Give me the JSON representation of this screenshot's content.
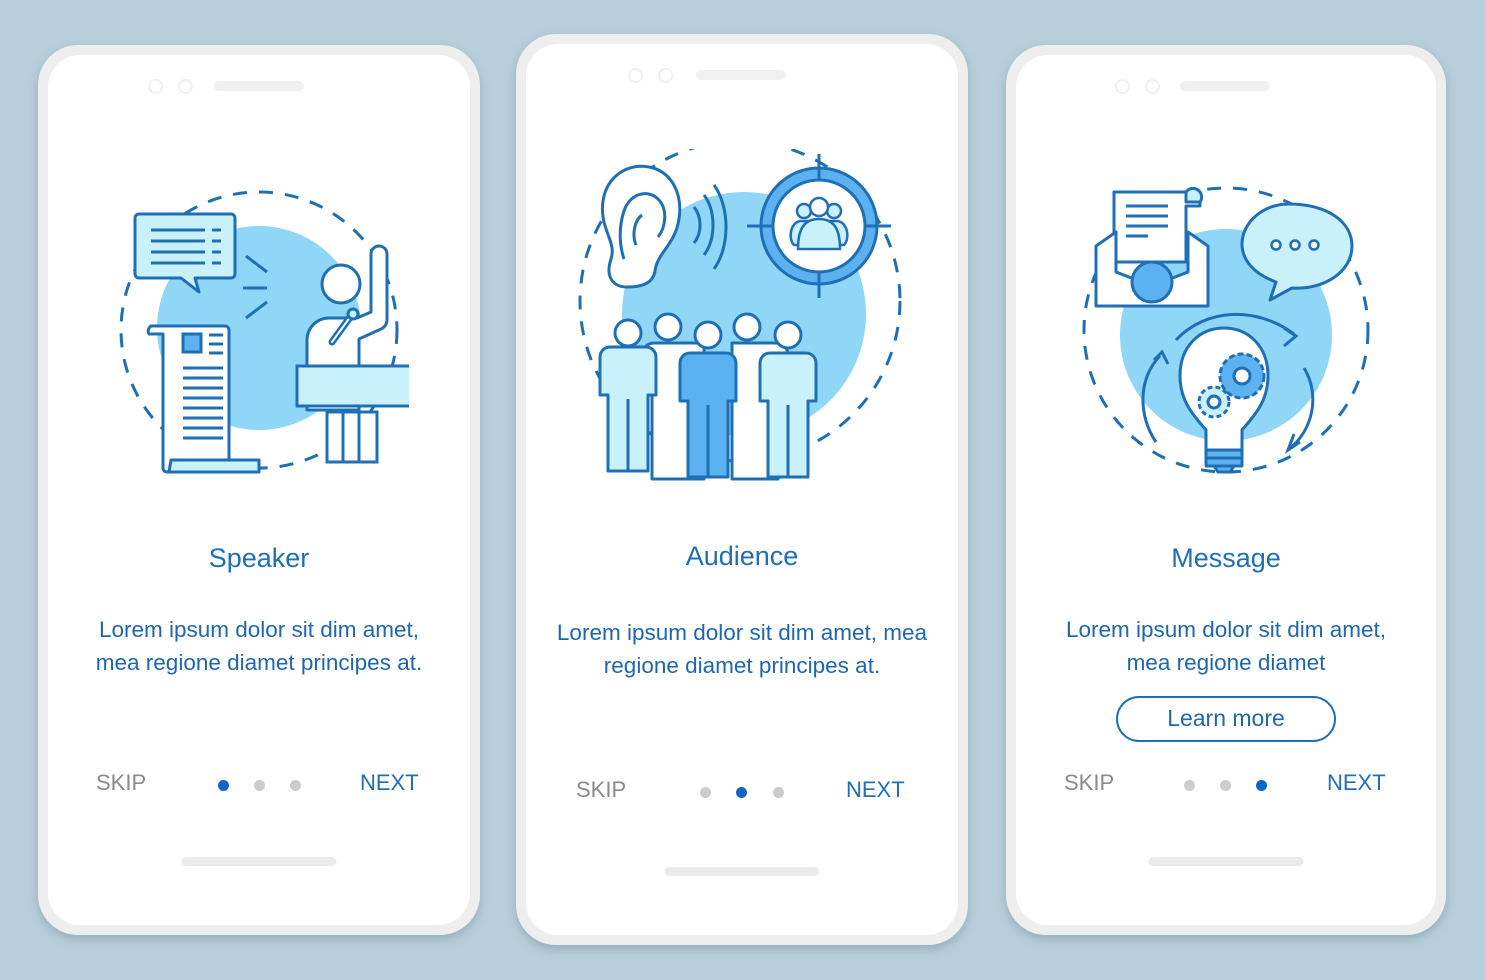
{
  "colors": {
    "background": "#b9cfdb",
    "accent": "#1f6fb5",
    "active_dot": "#0f66c2",
    "inactive_dot": "#cccccc",
    "skip_text": "#8a8a8a",
    "illustration_fill_light": "#8fd6f7",
    "illustration_fill_pale": "#c9f1fc",
    "illustration_fill_mid": "#5cb2f0"
  },
  "screens": [
    {
      "illustration": "speaker-illustration",
      "title": "Speaker",
      "body": "Lorem ipsum dolor sit dim amet, mea regione diamet principes at.",
      "skip_label": "SKIP",
      "next_label": "NEXT",
      "page_index": 1,
      "page_count": 3
    },
    {
      "illustration": "audience-illustration",
      "title": "Audience",
      "body": "Lorem ipsum dolor sit dim amet, mea regione diamet principes at.",
      "skip_label": "SKIP",
      "next_label": "NEXT",
      "page_index": 2,
      "page_count": 3
    },
    {
      "illustration": "message-illustration",
      "title": "Message",
      "body": "Lorem ipsum dolor sit dim amet, mea regione diamet",
      "button_label": "Learn more",
      "skip_label": "SKIP",
      "next_label": "NEXT",
      "page_index": 3,
      "page_count": 3
    }
  ]
}
